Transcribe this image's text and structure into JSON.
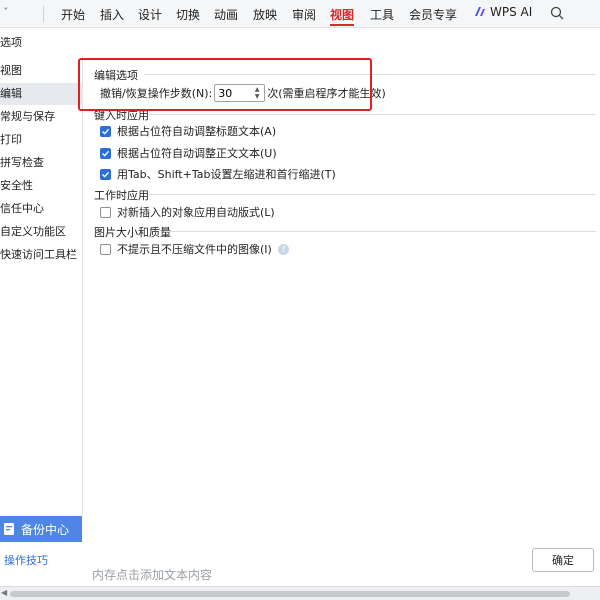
{
  "ribbon": {
    "caret": "ˇ",
    "tabs": [
      "开始",
      "插入",
      "设计",
      "切换",
      "动画",
      "放映",
      "审阅",
      "视图",
      "工具",
      "会员专享"
    ],
    "active_tab": "视图",
    "ai_label": "WPS AI",
    "accent": "#d42b2b"
  },
  "dialog": {
    "title": "选项",
    "nav": [
      "视图",
      "编辑",
      "常规与保存",
      "打印",
      "拼写检查",
      "安全性",
      "信任中心",
      "自定义功能区",
      "快速访问工具栏"
    ],
    "selected_nav": "编辑"
  },
  "edit_options": {
    "title": "编辑选项",
    "undo_label": "撤销/恢复操作步数(N):",
    "undo_value": "30",
    "undo_note": "次(需重启程序才能生效)"
  },
  "typing": {
    "title": "键入时应用",
    "items": [
      {
        "label": "根据占位符自动调整标题文本(A)",
        "checked": true
      },
      {
        "label": "根据占位符自动调整正文文本(U)",
        "checked": true
      },
      {
        "label": "用Tab、Shift+Tab设置左缩进和首行缩进(T)",
        "checked": true
      }
    ]
  },
  "working": {
    "title": "工作时应用",
    "items": [
      {
        "label": "对新插入的对象应用自动版式(L)",
        "checked": false
      }
    ]
  },
  "image": {
    "title": "图片大小和质量",
    "items": [
      {
        "label": "不提示且不压缩文件中的图像(I)",
        "checked": false
      }
    ]
  },
  "footer": {
    "backup_label": "备份中心",
    "tips_label": "操作技巧",
    "ok_label": "确定",
    "background_text": "内存点击添加文本内容"
  },
  "colors": {
    "checkbox_on": "#2b6fd6",
    "highlight_box": "#e02020",
    "backup_bg": "#4f86e6"
  }
}
